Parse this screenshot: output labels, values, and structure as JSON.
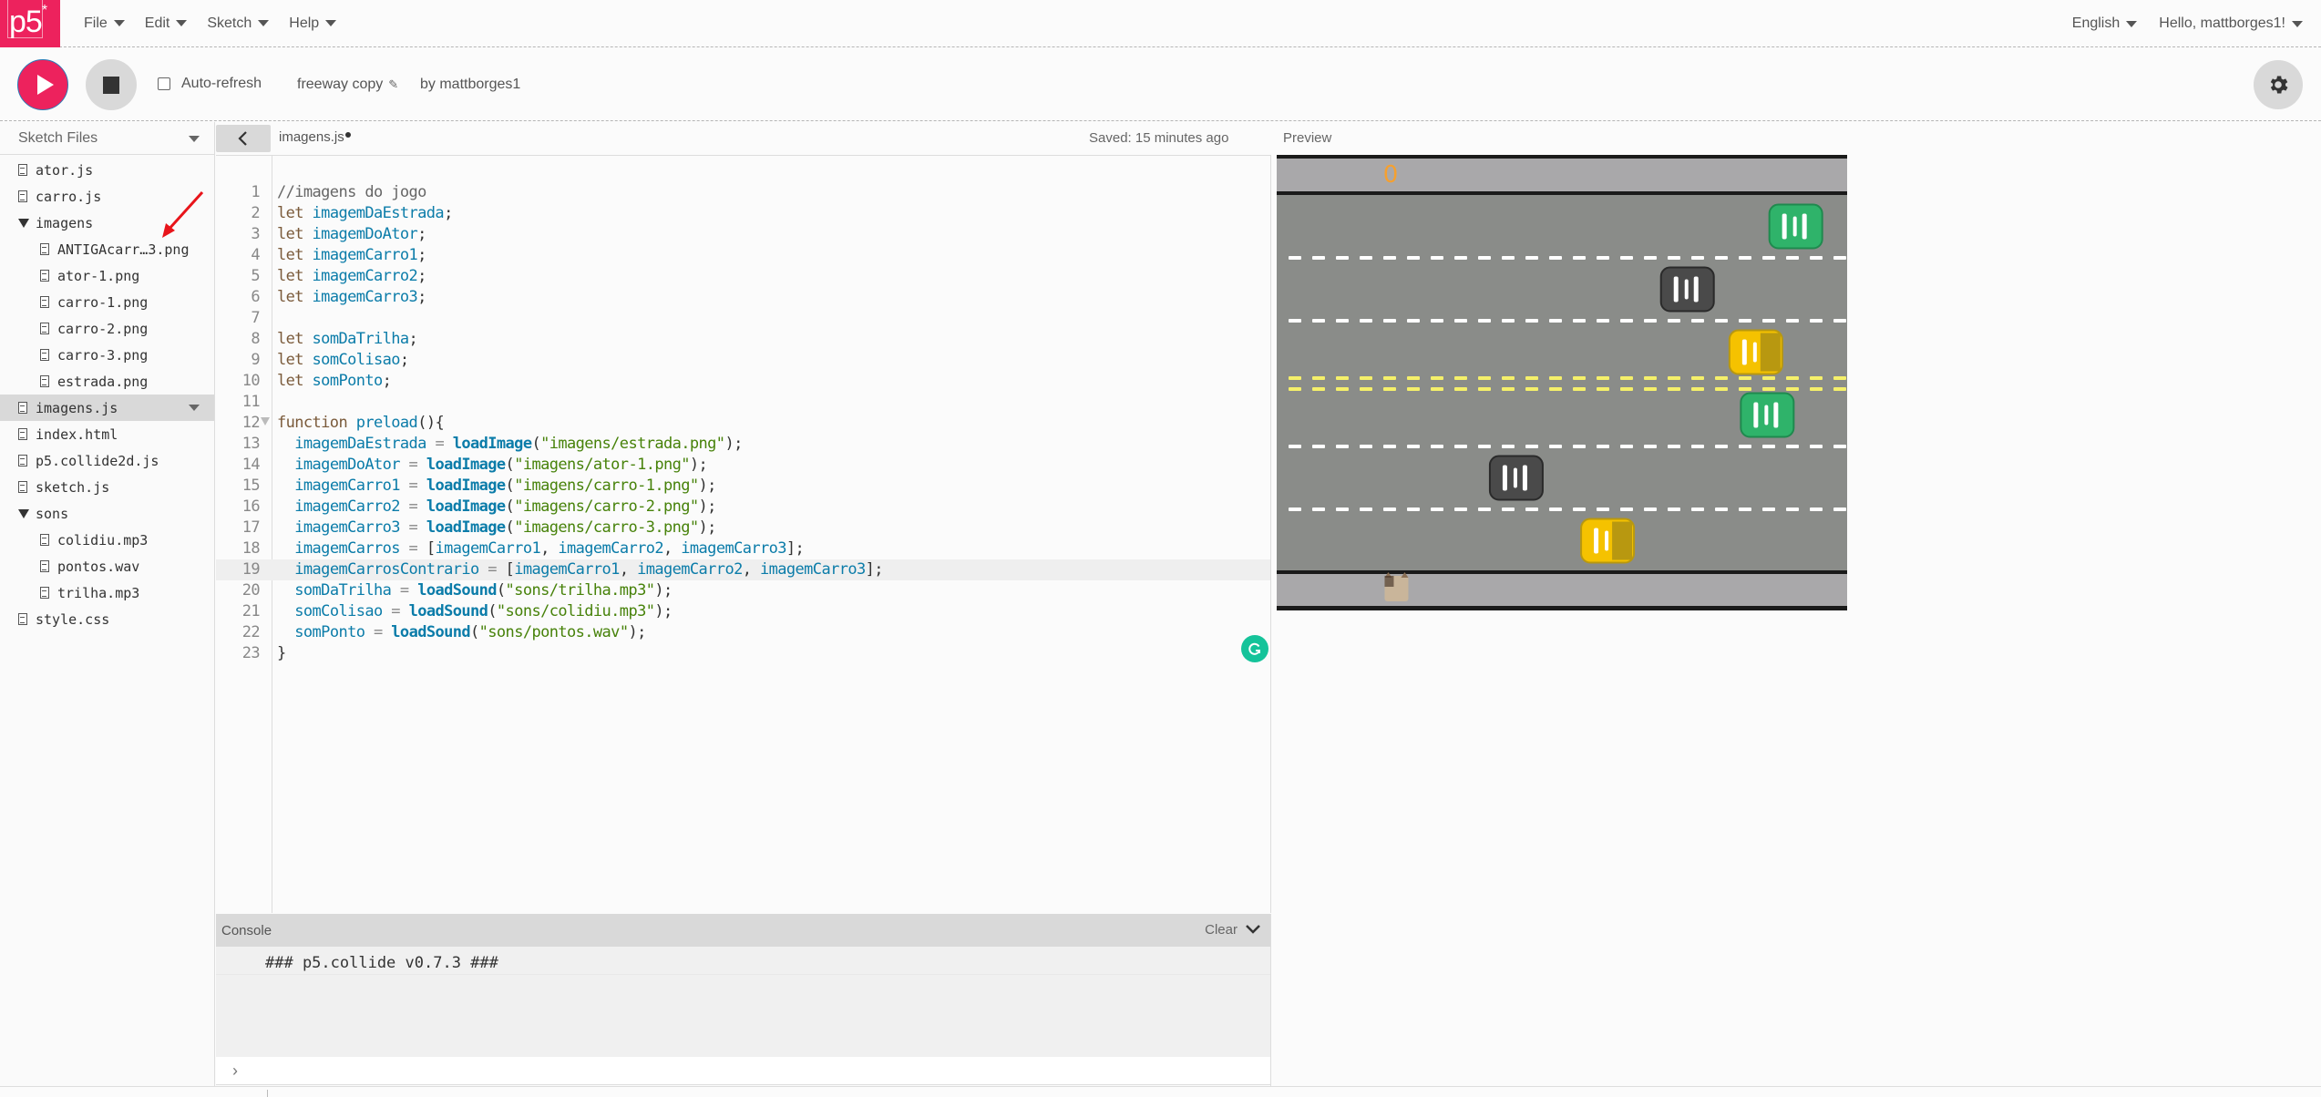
{
  "nav": {
    "logo": "p5",
    "logo_sup": "*",
    "menu": [
      {
        "label": "File"
      },
      {
        "label": "Edit"
      },
      {
        "label": "Sketch"
      },
      {
        "label": "Help"
      }
    ],
    "language": "English",
    "user_greeting": "Hello, mattborges1!"
  },
  "toolbar": {
    "auto_refresh_label": "Auto-refresh",
    "auto_refresh_checked": false,
    "sketch_name": "freeway copy",
    "by_user": "by mattborges1"
  },
  "sidebar": {
    "header": "Sketch Files",
    "files": [
      {
        "name": "ator.js",
        "type": "file",
        "level": 0
      },
      {
        "name": "carro.js",
        "type": "file",
        "level": 0
      },
      {
        "name": "imagens",
        "type": "folder",
        "level": 0,
        "expanded": true
      },
      {
        "name": "ANTIGAcarr…3.png",
        "type": "file",
        "level": 1
      },
      {
        "name": "ator-1.png",
        "type": "file",
        "level": 1
      },
      {
        "name": "carro-1.png",
        "type": "file",
        "level": 1
      },
      {
        "name": "carro-2.png",
        "type": "file",
        "level": 1
      },
      {
        "name": "carro-3.png",
        "type": "file",
        "level": 1
      },
      {
        "name": "estrada.png",
        "type": "file",
        "level": 1
      },
      {
        "name": "imagens.js",
        "type": "file",
        "level": 0,
        "selected": true
      },
      {
        "name": "index.html",
        "type": "file",
        "level": 0
      },
      {
        "name": "p5.collide2d.js",
        "type": "file",
        "level": 0
      },
      {
        "name": "sketch.js",
        "type": "file",
        "level": 0
      },
      {
        "name": "sons",
        "type": "folder",
        "level": 0,
        "expanded": true
      },
      {
        "name": "colidiu.mp3",
        "type": "file",
        "level": 1
      },
      {
        "name": "pontos.wav",
        "type": "file",
        "level": 1
      },
      {
        "name": "trilha.mp3",
        "type": "file",
        "level": 1
      },
      {
        "name": "style.css",
        "type": "file",
        "level": 0
      }
    ]
  },
  "editor": {
    "tab_name": "imagens.js",
    "unsaved": true,
    "saved_status": "Saved: 15 minutes ago",
    "active_line": 19,
    "lines": [
      "//imagens do jogo",
      "let imagemDaEstrada;",
      "let imagemDoAtor;",
      "let imagemCarro1;",
      "let imagemCarro2;",
      "let imagemCarro3;",
      "",
      "let somDaTrilha;",
      "let somColisao;",
      "let somPonto;",
      "",
      "function preload(){",
      "  imagemDaEstrada = loadImage(\"imagens/estrada.png\");",
      "  imagemDoAtor = loadImage(\"imagens/ator-1.png\");",
      "  imagemCarro1 = loadImage(\"imagens/carro-1.png\");",
      "  imagemCarro2 = loadImage(\"imagens/carro-2.png\");",
      "  imagemCarro3 = loadImage(\"imagens/carro-3.png\");",
      "  imagemCarros = [imagemCarro1, imagemCarro2, imagemCarro3];",
      "  imagemCarrosContrario = [imagemCarro1, imagemCarro2, imagemCarro3];",
      "  somDaTrilha = loadSound(\"sons/trilha.mp3\");",
      "  somColisao = loadSound(\"sons/colidiu.mp3\");",
      "  somPonto = loadSound(\"sons/pontos.wav\");",
      "}"
    ]
  },
  "console": {
    "title": "Console",
    "clear_label": "Clear",
    "messages": [
      "### p5.collide v0.7.3 ###"
    ],
    "prompt": "›"
  },
  "preview": {
    "label": "Preview",
    "score": "0",
    "colors": {
      "sidewalk": "#a9a8aa",
      "road": "#8a8c89",
      "curb": "#1a1a1a",
      "lane_white": "#ffffff",
      "lane_yellow": "#f5f06a",
      "score": "#f5a030"
    },
    "cars": [
      {
        "lane": 1,
        "color": "green",
        "position": 0.91
      },
      {
        "lane": 2,
        "color": "dark",
        "position": 0.72
      },
      {
        "lane": 3,
        "color": "yellow",
        "position": 0.84
      },
      {
        "lane": 4,
        "color": "green",
        "position": 0.86
      },
      {
        "lane": 5,
        "color": "dark",
        "position": 0.42
      },
      {
        "lane": 6,
        "color": "yellow",
        "position": 0.58
      }
    ],
    "actor": {
      "name": "cat-actor",
      "position": 0.21
    }
  },
  "theme": {
    "accent": "#ed225d",
    "grammarly": "#15c39a"
  }
}
